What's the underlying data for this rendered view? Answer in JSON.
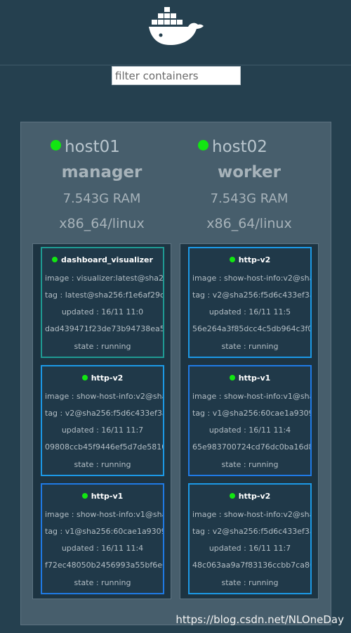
{
  "filter": {
    "placeholder": "filter containers"
  },
  "colors": {
    "background": "#25404f",
    "panel": "#475e6c",
    "status_green": "#12e612",
    "card_blue": "#1f7ae5",
    "card_teal": "#1f9a93"
  },
  "hosts": [
    {
      "name": "host01",
      "role": "manager",
      "ram": "7.543G RAM",
      "arch": "x86_64/linux",
      "containers": [
        {
          "name": "dashboard_visualizer",
          "image": "image : visualizer:latest@sha256:",
          "tag": "tag : latest@sha256:f1e6af29c",
          "updated": "updated : 16/11 11:0",
          "id": "dad439471f23de73b94738ea5",
          "state": "state : running"
        },
        {
          "name": "http-v2",
          "image": "image : show-host-info:v2@sha",
          "tag": "tag : v2@sha256:f5d6c433ef3a",
          "updated": "updated : 16/11 11:7",
          "id": "09808ccb45f9446ef5d7de5810",
          "state": "state : running"
        },
        {
          "name": "http-v1",
          "image": "image : show-host-info:v1@sha",
          "tag": "tag : v1@sha256:60cae1a9309",
          "updated": "updated : 16/11 11:4",
          "id": "f72ec48050b2456993a55bf6e6",
          "state": "state : running"
        }
      ]
    },
    {
      "name": "host02",
      "role": "worker",
      "ram": "7.543G RAM",
      "arch": "x86_64/linux",
      "containers": [
        {
          "name": "http-v2",
          "image": "image : show-host-info:v2@sha",
          "tag": "tag : v2@sha256:f5d6c433ef3a",
          "updated": "updated : 16/11 11:5",
          "id": "56e264a3f85dcc4c5db964c3f0",
          "state": "state : running"
        },
        {
          "name": "http-v1",
          "image": "image : show-host-info:v1@sha",
          "tag": "tag : v1@sha256:60cae1a9309",
          "updated": "updated : 16/11 11:4",
          "id": "65e983700724cd76dc0ba16d8",
          "state": "state : running"
        },
        {
          "name": "http-v2",
          "image": "image : show-host-info:v2@sha",
          "tag": "tag : v2@sha256:f5d6c433ef3a",
          "updated": "updated : 16/11 11:7",
          "id": "48c063aa9a7f83136ccbb7ca80",
          "state": "state : running"
        }
      ]
    }
  ],
  "watermark": "https://blog.csdn.net/NLOneDay"
}
